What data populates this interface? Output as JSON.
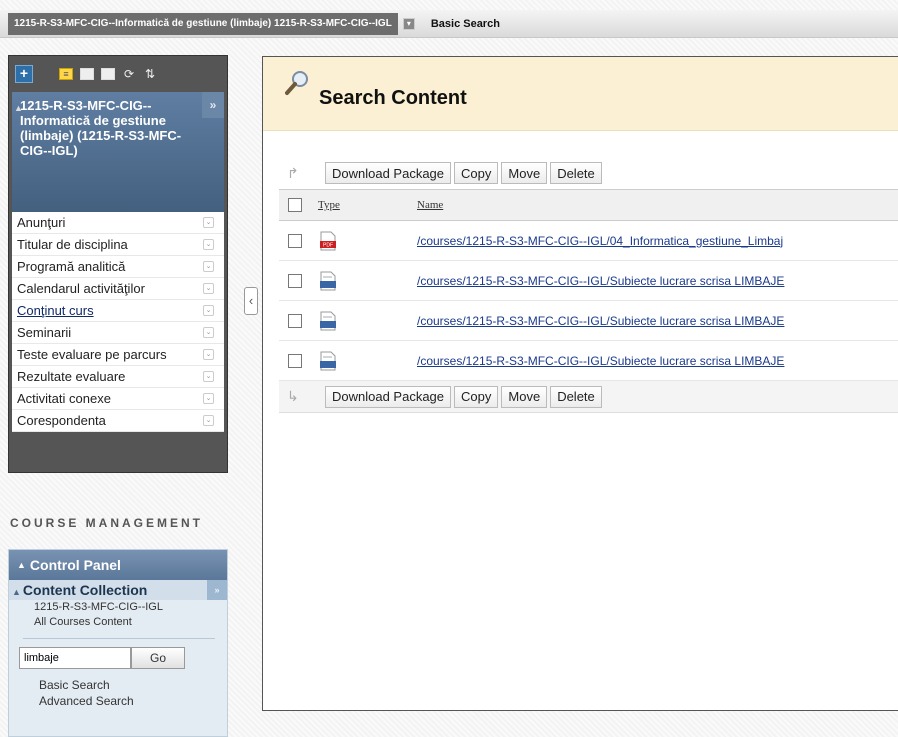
{
  "breadcrumb": {
    "course": "1215-R-S3-MFC-CIG--Informatică de gestiune (limbaje) 1215-R-S3-MFC-CIG--IGL",
    "current": "Basic Search"
  },
  "course_menu": {
    "title": "1215-R-S3-MFC-CIG--Informatică de gestiune (limbaje) (1215-R-S3-MFC-CIG--IGL)",
    "items": [
      {
        "label": "Anunţuri"
      },
      {
        "label": "Titular de disciplina"
      },
      {
        "label": "Programă analitică"
      },
      {
        "label": "Calendarul activităţilor"
      },
      {
        "label": "Conţinut curs"
      },
      {
        "label": "Seminarii"
      },
      {
        "label": "Teste evaluare pe parcurs"
      },
      {
        "label": "Rezultate evaluare"
      },
      {
        "label": "Activitati conexe"
      },
      {
        "label": "Corespondenta"
      }
    ]
  },
  "course_management": {
    "heading": "COURSE MANAGEMENT",
    "control_panel": "Control Panel",
    "content_collection": "Content Collection",
    "collection_links": [
      "1215-R-S3-MFC-CIG--IGL",
      "All Courses Content"
    ],
    "search_value": "limbaje",
    "go_label": "Go",
    "search_links": [
      "Basic Search",
      "Advanced Search"
    ]
  },
  "main": {
    "title": "Search Content",
    "actions": [
      "Download Package",
      "Copy",
      "Move",
      "Delete"
    ],
    "columns": {
      "type": "Type",
      "name": "Name"
    },
    "rows": [
      {
        "type_icon": "pdf-file-icon",
        "name": "/courses/1215-R-S3-MFC-CIG--IGL/04_Informatica_gestiune_Limbaj"
      },
      {
        "type_icon": "doc-file-icon",
        "name": "/courses/1215-R-S3-MFC-CIG--IGL/Subiecte lucrare scrisa LIMBAJE"
      },
      {
        "type_icon": "doc-file-icon",
        "name": "/courses/1215-R-S3-MFC-CIG--IGL/Subiecte lucrare scrisa LIMBAJE"
      },
      {
        "type_icon": "doc-file-icon",
        "name": "/courses/1215-R-S3-MFC-CIG--IGL/Subiecte lucrare scrisa LIMBAJE"
      }
    ]
  },
  "colors": {
    "header_bg": "#fbf0d3",
    "menu_title": "#4f6d8f",
    "link": "#1a3a8c"
  }
}
